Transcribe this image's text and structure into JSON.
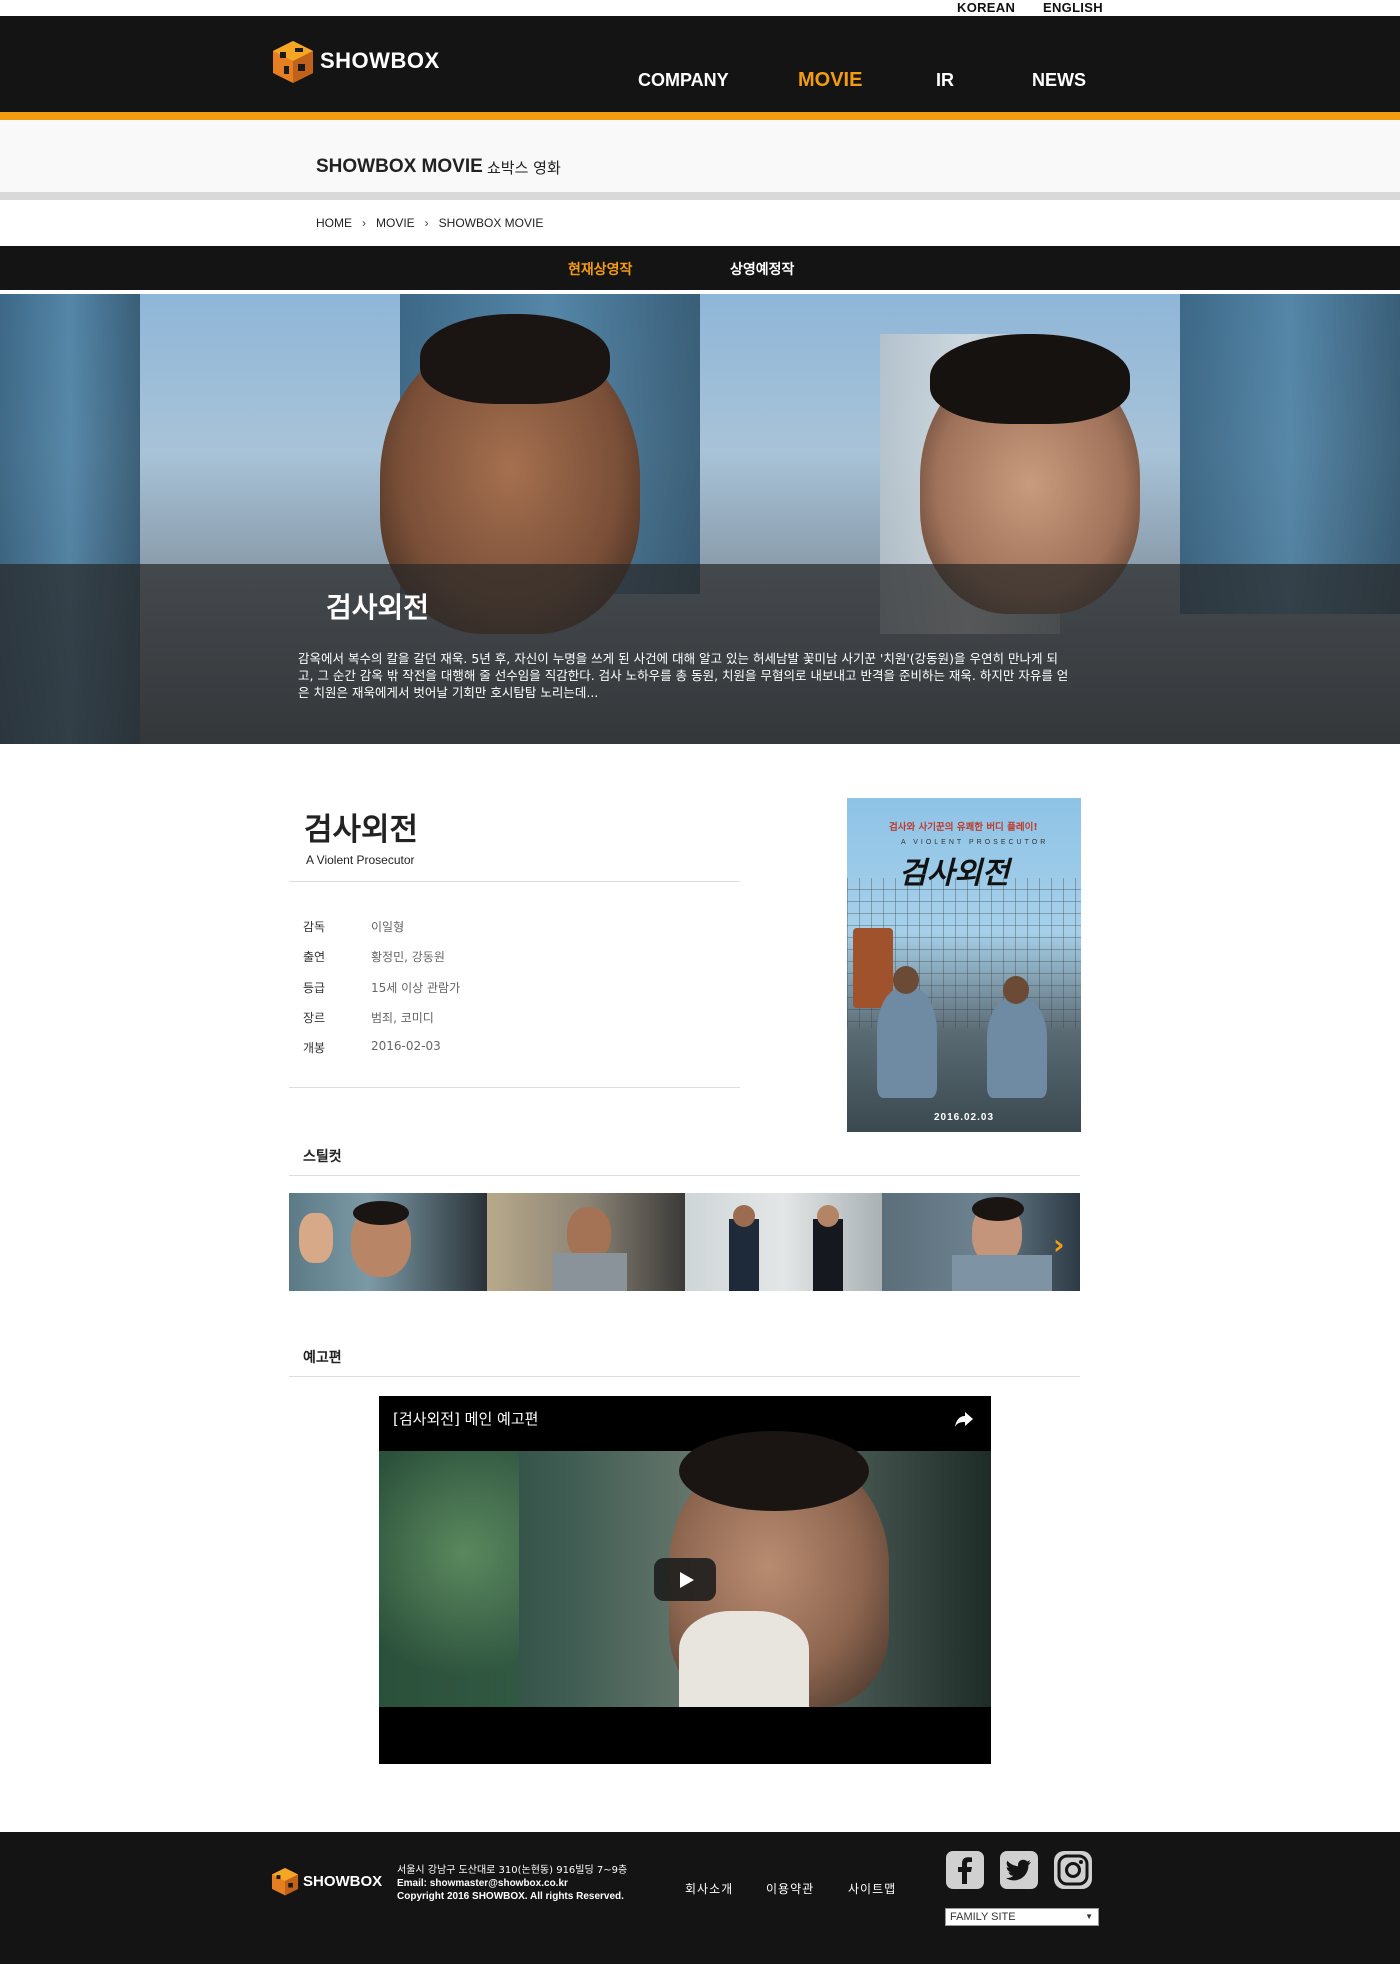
{
  "lang": {
    "korean": "KOREAN",
    "english": "ENGLISH"
  },
  "brand": {
    "name": "SHOWBOX",
    "accent": "#f39c12",
    "dark": "#141414"
  },
  "nav": [
    {
      "label": "COMPANY",
      "active": false
    },
    {
      "label": "MOVIE",
      "active": true
    },
    {
      "label": "IR",
      "active": false
    },
    {
      "label": "NEWS",
      "active": false
    }
  ],
  "section": {
    "title": "SHOWBOX MOVIE",
    "subtitle": "쇼박스 영화"
  },
  "breadcrumb": [
    "HOME",
    "MOVIE",
    "SHOWBOX MOVIE"
  ],
  "subtabs": [
    {
      "label": "현재상영작",
      "active": true
    },
    {
      "label": "상영예정작",
      "active": false
    }
  ],
  "hero": {
    "title": "검사외전",
    "description": "감옥에서 복수의 칼을 갈던 재욱. 5년 후, 자신이 누명을 쓰게 된 사건에 대해 알고 있는 허세남발 꽃미남 사기꾼 '치원'(강동원)을 우연히 만나게 되고, 그 순간 감옥 밖 작전을 대행해 줄 선수임을 직감한다. 검사 노하우를 총 동원, 치원을 무혐의로 내보내고 반격을 준비하는 재욱. 하지만 자유를 얻은 치원은 재욱에게서 벗어날 기회만 호시탐탐 노리는데..."
  },
  "movie": {
    "title": "검사외전",
    "title_en": "A Violent Prosecutor",
    "info": [
      {
        "key": "감독",
        "value": "이일형"
      },
      {
        "key": "출연",
        "value": "황정민, 강동원"
      },
      {
        "key": "등급",
        "value": "15세 이상 관람가"
      },
      {
        "key": "장르",
        "value": "범죄, 코미디"
      },
      {
        "key": "개봉",
        "value": "2016-02-03"
      }
    ]
  },
  "poster": {
    "tagline": "검사와 사기꾼의 유쾌한 버디 플레이!",
    "sub": "A VIOLENT PROSECUTOR",
    "title": "검사외전",
    "date": "2016.02.03"
  },
  "stills": {
    "label": "스틸컷",
    "next_icon": "chevron-right-icon"
  },
  "trailer": {
    "label": "예고편",
    "video_title": "[검사외전] 메인 예고편",
    "share_icon": "share-icon",
    "play_icon": "play-icon"
  },
  "footer": {
    "address": "서울시 강남구 도산대로 310(논현동) 916빌딩 7~9층",
    "email": "Email: showmaster@showbox.co.kr",
    "copyright": "Copyright 2016 SHOWBOX. All rights Reserved.",
    "links": [
      "회사소개",
      "이용약관",
      "사이트맵"
    ],
    "social": [
      "facebook-icon",
      "twitter-icon",
      "instagram-icon"
    ],
    "family_site": "FAMILY SITE"
  }
}
